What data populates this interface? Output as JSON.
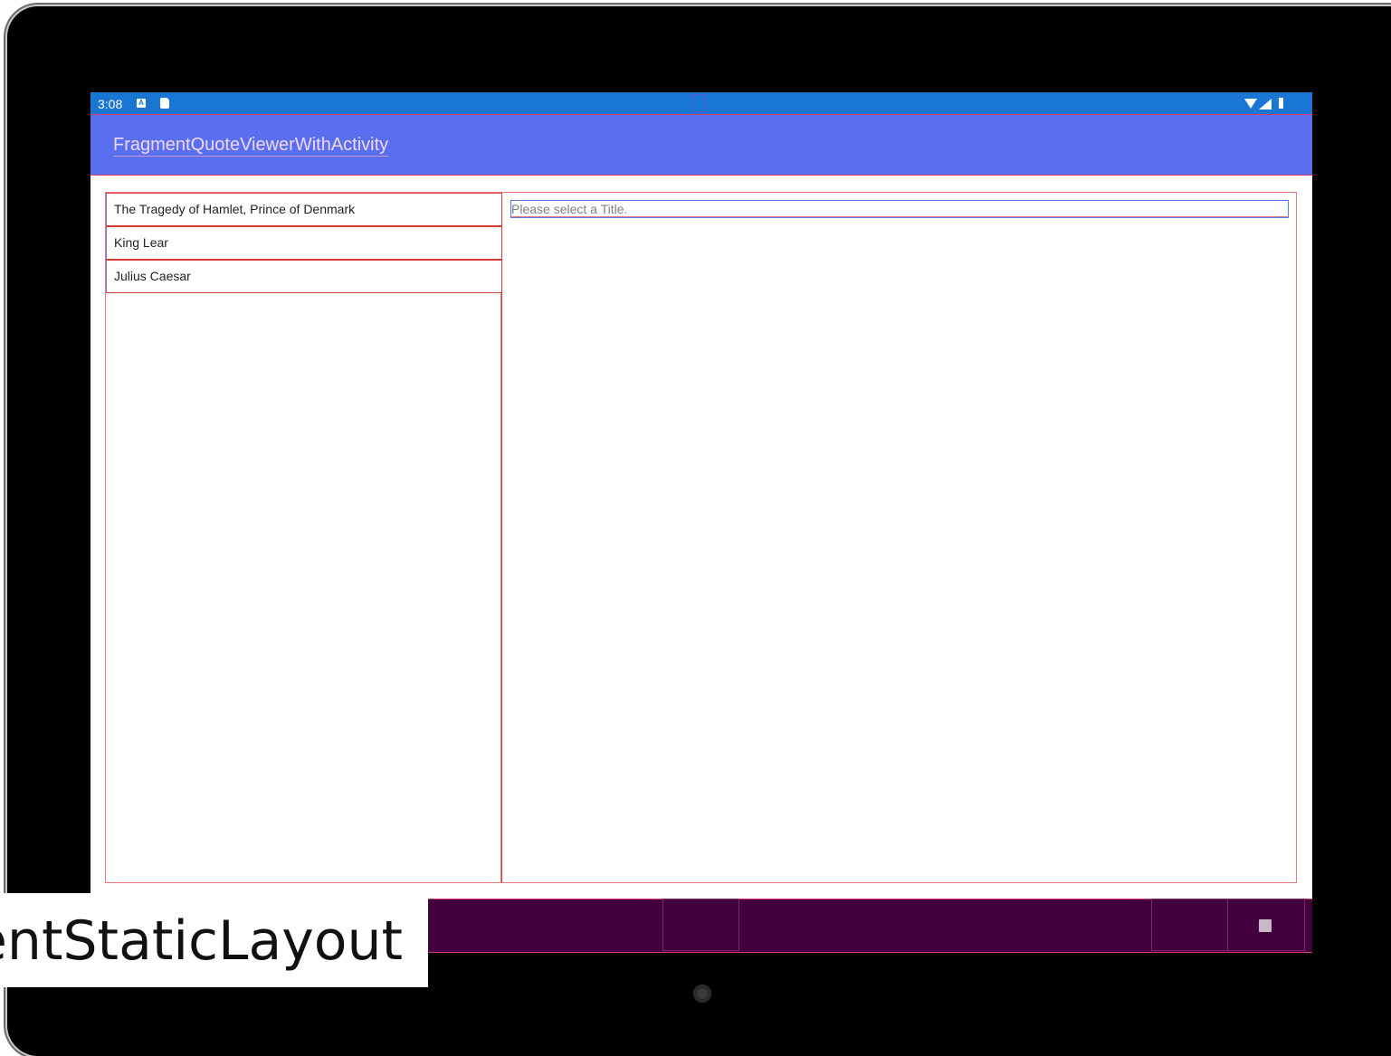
{
  "status_bar": {
    "time": "3:08",
    "icons": [
      "a-notification-icon",
      "sd-card-icon",
      "wifi-icon",
      "signal-icon",
      "battery-icon"
    ]
  },
  "action_bar": {
    "title": "FragmentQuoteViewerWithActivity"
  },
  "title_list": {
    "items": [
      "The Tragedy of Hamlet, Prince of Denmark",
      "King Lear",
      "Julius Caesar"
    ]
  },
  "quote_panel": {
    "text": "Please select a Title."
  },
  "nav_bar": {
    "icons": [
      "recents-icon"
    ]
  },
  "caption": {
    "text": "entStaticLayout"
  },
  "colors": {
    "status_bar": "#1976d2",
    "action_bar": "#5a6ff0",
    "nav_bar": "#42003f",
    "device_frame": "#000000"
  }
}
